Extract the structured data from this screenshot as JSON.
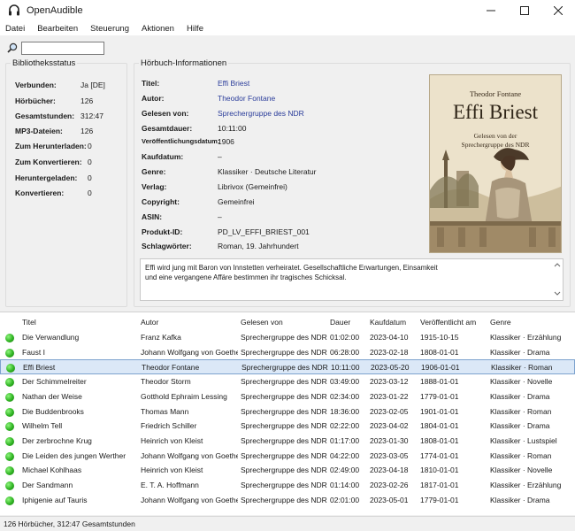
{
  "window": {
    "title": "OpenAudible"
  },
  "menu": [
    "Datei",
    "Bearbeiten",
    "Steuerung",
    "Aktionen",
    "Hilfe"
  ],
  "search": {
    "value": ""
  },
  "library_status": {
    "title": "Bibliotheksstatus",
    "rows": [
      {
        "label": "Verbunden:",
        "value": "Ja [DE]"
      },
      {
        "label": "Hörbücher:",
        "value": "126"
      },
      {
        "label": "Gesamtstunden:",
        "value": "312:47"
      },
      {
        "label": "MP3-Dateien:",
        "value": "126"
      },
      {
        "label": "Zum Herunterladen:",
        "value": "0"
      },
      {
        "label": "Zum Konvertieren:",
        "value": "0"
      },
      {
        "label": "Heruntergeladen:",
        "value": "0"
      },
      {
        "label": "Konvertieren:",
        "value": "0"
      }
    ]
  },
  "audiobook_info": {
    "title": "Hörbuch-Informationen",
    "rows": [
      {
        "label": "Titel:",
        "value": "Effi Briest"
      },
      {
        "label": "Autor:",
        "value": "Theodor Fontane"
      },
      {
        "label": "Gelesen von:",
        "value": "Sprechergruppe des NDR"
      },
      {
        "label": "Gesamtdauer:",
        "value": "10:11:00"
      },
      {
        "label": "Veröffentlichungsdatum:",
        "value": "1906"
      },
      {
        "label": "Kaufdatum:",
        "value": "–"
      },
      {
        "label": "Genre:",
        "value": "Klassiker · Deutsche Literatur"
      },
      {
        "label": "Verlag:",
        "value": "Librivox (Gemeinfrei)"
      },
      {
        "label": "Copyright:",
        "value": "Gemeinfrei"
      },
      {
        "label": "ASIN:",
        "value": "–"
      },
      {
        "label": "Produkt-ID:",
        "value": "PD_LV_EFFI_BRIEST_001"
      },
      {
        "label": "Schlagwörter:",
        "value": "Roman, 19. Jahrhundert"
      }
    ],
    "cover": {
      "author": "Theodor Fontane",
      "title": "Effi Briest",
      "subtitle_line1": "Gelesen von der",
      "subtitle_line2": "Sprechergruppe des NDR"
    },
    "description_line1": "Effi wird jung mit Baron von Innstetten verheiratet. Gesellschaftliche Erwartungen, Einsamkeit",
    "description_line2": "und eine vergangene Affäre bestimmen ihr tragisches Schicksal."
  },
  "list": {
    "columns": [
      "Titel",
      "Autor",
      "Gelesen von",
      "Dauer",
      "Kaufdatum",
      "Veröffentlicht am",
      "Genre"
    ],
    "rows": [
      [
        "Die Verwandlung",
        "Franz Kafka",
        "Sprechergruppe des NDR",
        "01:02:00",
        "2023-04-10",
        "1915-10-15",
        "Klassiker · Erzählung"
      ],
      [
        "Faust I",
        "Johann Wolfgang von Goethe",
        "Sprechergruppe des NDR",
        "06:28:00",
        "2023-02-18",
        "1808-01-01",
        "Klassiker · Drama"
      ],
      [
        "Effi Briest",
        "Theodor Fontane",
        "Sprechergruppe des NDR",
        "10:11:00",
        "2023-05-20",
        "1906-01-01",
        "Klassiker · Roman"
      ],
      [
        "Der Schimmelreiter",
        "Theodor Storm",
        "Sprechergruppe des NDR",
        "03:49:00",
        "2023-03-12",
        "1888-01-01",
        "Klassiker · Novelle"
      ],
      [
        "Nathan der Weise",
        "Gotthold Ephraim Lessing",
        "Sprechergruppe des NDR",
        "02:34:00",
        "2023-01-22",
        "1779-01-01",
        "Klassiker · Drama"
      ],
      [
        "Die Buddenbrooks",
        "Thomas Mann",
        "Sprechergruppe des NDR",
        "18:36:00",
        "2023-02-05",
        "1901-01-01",
        "Klassiker · Roman"
      ],
      [
        "Wilhelm Tell",
        "Friedrich Schiller",
        "Sprechergruppe des NDR",
        "02:22:00",
        "2023-04-02",
        "1804-01-01",
        "Klassiker · Drama"
      ],
      [
        "Der zerbrochne Krug",
        "Heinrich von Kleist",
        "Sprechergruppe des NDR",
        "01:17:00",
        "2023-01-30",
        "1808-01-01",
        "Klassiker · Lustspiel"
      ],
      [
        "Die Leiden des jungen Werther",
        "Johann Wolfgang von Goethe",
        "Sprechergruppe des NDR",
        "04:22:00",
        "2023-03-05",
        "1774-01-01",
        "Klassiker · Roman"
      ],
      [
        "Michael Kohlhaas",
        "Heinrich von Kleist",
        "Sprechergruppe des NDR",
        "02:49:00",
        "2023-04-18",
        "1810-01-01",
        "Klassiker · Novelle"
      ],
      [
        "Der Sandmann",
        "E. T. A. Hoffmann",
        "Sprechergruppe des NDR",
        "01:14:00",
        "2023-02-26",
        "1817-01-01",
        "Klassiker · Erzählung"
      ],
      [
        "Iphigenie auf Tauris",
        "Johann Wolfgang von Goethe",
        "Sprechergruppe des NDR",
        "02:01:00",
        "2023-05-01",
        "1779-01-01",
        "Klassiker · Drama"
      ]
    ],
    "selected_index": 2
  },
  "statusbar": {
    "text": "126 Hörbücher, 312:47 Gesamtstunden"
  },
  "colors": {
    "accent": "#2a3c9a",
    "selection": "#dbe8f7",
    "status_green": "#2fb322"
  }
}
